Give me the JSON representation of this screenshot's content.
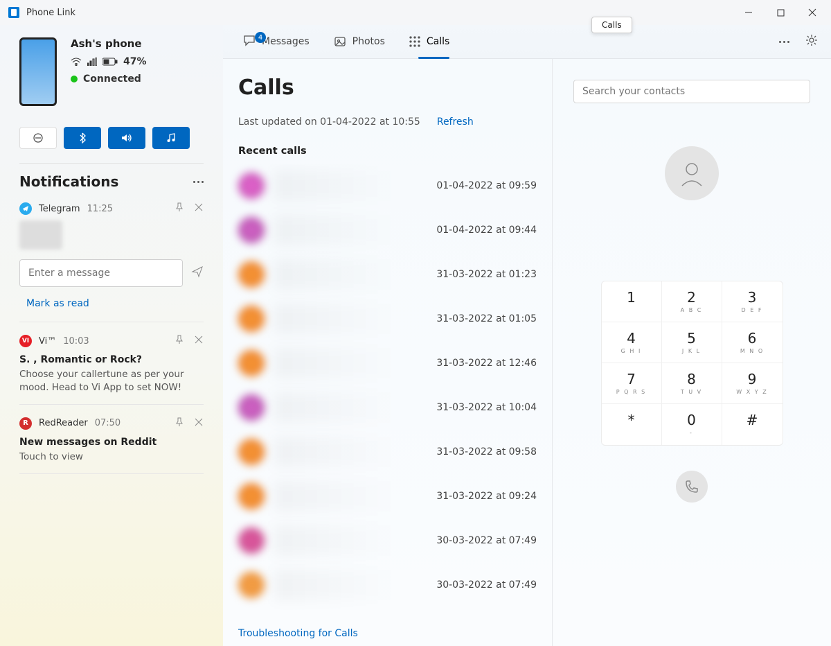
{
  "app_title": "Phone Link",
  "tooltip": "Calls",
  "tabs": {
    "messages": "Messages",
    "messages_badge": "4",
    "photos": "Photos",
    "calls": "Calls"
  },
  "device": {
    "name": "Ash's phone",
    "battery": "47%",
    "connection": "Connected"
  },
  "notifications_header": "Notifications",
  "notif1": {
    "app": "Telegram",
    "time": "11:25",
    "placeholder": "Enter a message",
    "mark_read": "Mark as read"
  },
  "notif2": {
    "app": "Vi™",
    "time": "10:03",
    "title": "S. , Romantic or Rock?",
    "body": "Choose your callertune as per your mood. Head to Vi App to set NOW!"
  },
  "notif3": {
    "app": "RedReader",
    "time": "07:50",
    "title": "New messages on Reddit",
    "body": "Touch to view"
  },
  "calls": {
    "heading": "Calls",
    "updated": "Last updated on 01-04-2022 at 10:55",
    "refresh": "Refresh",
    "recent_header": "Recent calls",
    "troubleshoot": "Troubleshooting for Calls",
    "times": {
      "t0": "01-04-2022 at 09:59",
      "t1": "01-04-2022 at 09:44",
      "t2": "31-03-2022 at 01:23",
      "t3": "31-03-2022 at 01:05",
      "t4": "31-03-2022 at 12:46",
      "t5": "31-03-2022 at 10:04",
      "t6": "31-03-2022 at 09:58",
      "t7": "31-03-2022 at 09:24",
      "t8": "30-03-2022 at 07:49",
      "t9": "30-03-2022 at 07:49"
    }
  },
  "dialer": {
    "search_placeholder": "Search your contacts",
    "keys": {
      "k1d": "1",
      "k1l": "",
      "k2d": "2",
      "k2l": "A B C",
      "k3d": "3",
      "k3l": "D E F",
      "k4d": "4",
      "k4l": "G H I",
      "k5d": "5",
      "k5l": "J K L",
      "k6d": "6",
      "k6l": "M N O",
      "k7d": "7",
      "k7l": "P Q R S",
      "k8d": "8",
      "k8l": "T U V",
      "k9d": "9",
      "k9l": "W X Y Z",
      "ksd": "*",
      "ksl": "",
      "k0d": "0",
      "k0l": "-",
      "khd": "#",
      "khl": ""
    }
  }
}
